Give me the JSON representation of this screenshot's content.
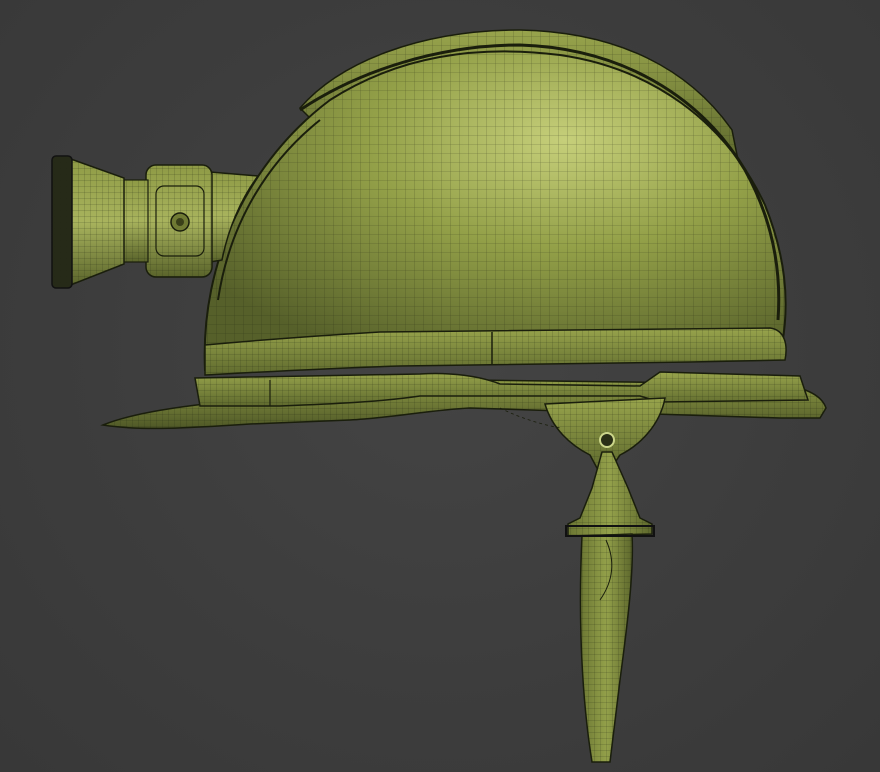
{
  "scene": {
    "subject": "mining-hard-hat-wireframe",
    "colors": {
      "background": "#3d3d3d",
      "shell": "#7f8c3c",
      "shell_light": "#b9c46c",
      "shell_dark": "#4c5424",
      "wire": "#1e2310",
      "lamp_bezel": "#262a18"
    }
  }
}
